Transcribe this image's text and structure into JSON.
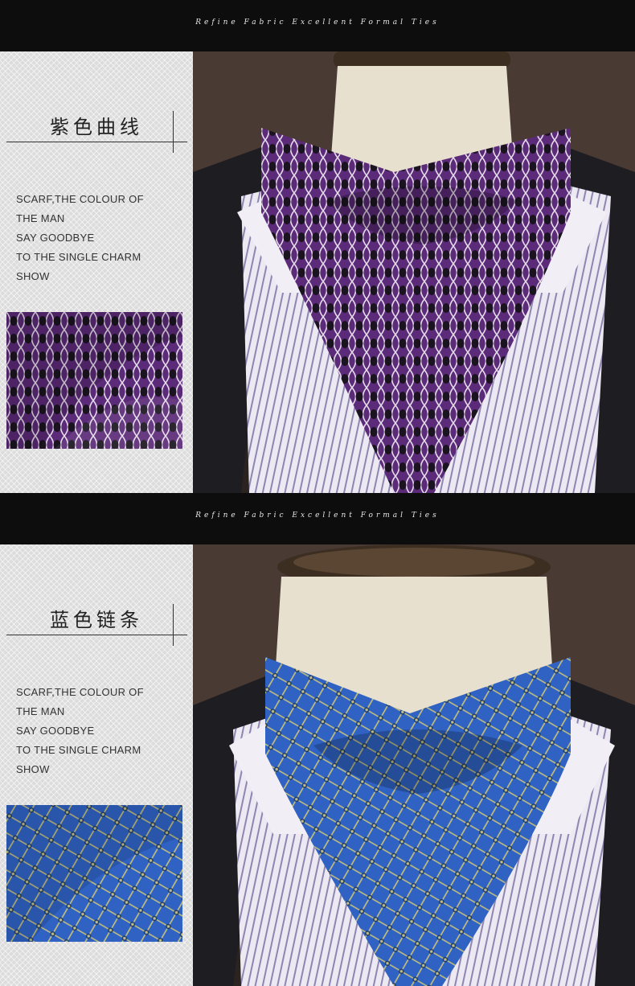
{
  "sections": [
    {
      "banner_text": "Refine Fabric Excellent Formal Ties",
      "title": "紫色曲线",
      "slogan": [
        "SCARF,THE COLOUR OF",
        "THE MAN",
        "SAY GOODBYE",
        "TO THE SINGLE CHARM",
        "SHOW"
      ],
      "ascot_color": "#5b2a78",
      "pattern_color": "#1b1420",
      "highlight_color": "#e4dbe9"
    },
    {
      "banner_text": "Refine Fabric Excellent Formal Ties",
      "title": "蓝色链条",
      "slogan": [
        "SCARF,THE COLOUR OF",
        "THE MAN",
        "SAY GOODBYE",
        "TO THE SINGLE CHARM",
        "SHOW"
      ],
      "ascot_color": "#2f62c2",
      "pattern_color": "#1e3a66",
      "highlight_color": "#c9c27a"
    }
  ]
}
